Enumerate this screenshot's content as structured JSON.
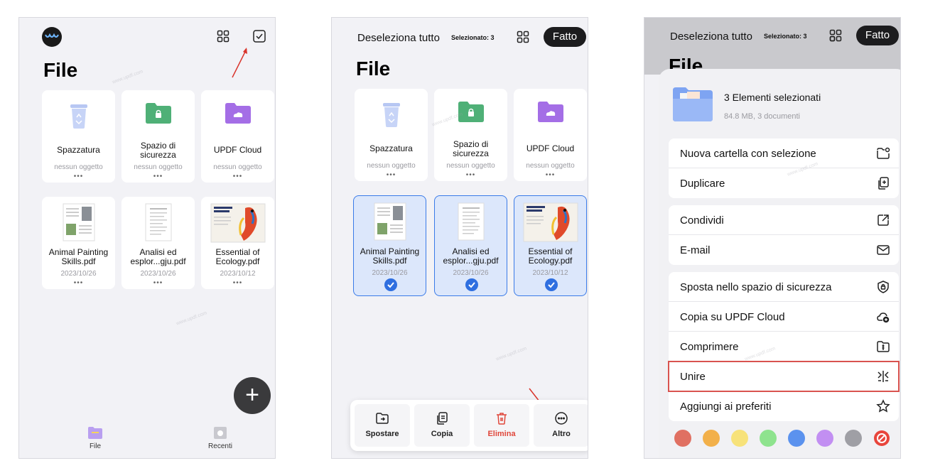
{
  "screen1": {
    "title": "File",
    "cards": [
      {
        "name": "Spazzatura",
        "sub": "nessun oggetto",
        "more": "•••"
      },
      {
        "name": "Spazio di sicurezza",
        "sub": "nessun oggetto",
        "more": "•••"
      },
      {
        "name": "UPDF Cloud",
        "sub": "nessun oggetto",
        "more": "•••"
      },
      {
        "name": "Animal Painting Skills.pdf",
        "sub": "2023/10/26",
        "more": "•••"
      },
      {
        "name": "Analisi ed esplor...gju.pdf",
        "sub": "2023/10/26",
        "more": "•••"
      },
      {
        "name": "Essential of Ecology.pdf",
        "sub": "2023/10/12",
        "more": "•••"
      }
    ],
    "fab": "+",
    "tabs": [
      {
        "label": "File"
      },
      {
        "label": "Recenti"
      }
    ]
  },
  "screen2": {
    "deselect": "Deseleziona tutto",
    "selected": "Selezionato: 3",
    "done": "Fatto",
    "title": "File",
    "cards": [
      {
        "name": "Spazzatura",
        "sub": "nessun oggetto",
        "more": "•••"
      },
      {
        "name": "Spazio di sicurezza",
        "sub": "nessun oggetto",
        "more": "•••"
      },
      {
        "name": "UPDF Cloud",
        "sub": "nessun oggetto",
        "more": "•••"
      },
      {
        "name": "Animal Painting Skills.pdf",
        "sub": "2023/10/26"
      },
      {
        "name": "Analisi ed esplor...gju.pdf",
        "sub": "2023/10/26"
      },
      {
        "name": "Essential of Ecology.pdf",
        "sub": "2023/10/12"
      }
    ],
    "actions": [
      {
        "label": "Spostare"
      },
      {
        "label": "Copia"
      },
      {
        "label": "Elimina"
      },
      {
        "label": "Altro"
      }
    ]
  },
  "screen3": {
    "deselect": "Deseleziona tutto",
    "selected": "Selezionato: 3",
    "done": "Fatto",
    "title": "File",
    "sel_title": "3 Elementi selezionati",
    "sel_sub": "84.8 MB, 3 documenti",
    "group1": [
      "Nuova cartella con selezione",
      "Duplicare"
    ],
    "group2": [
      "Condividi",
      "E-mail"
    ],
    "group3": [
      "Sposta nello spazio di sicurezza",
      "Copia su UPDF Cloud",
      "Comprimere",
      "Unire",
      "Aggiungi ai preferiti"
    ],
    "colors": [
      "#e07062",
      "#f2b04a",
      "#f7e27a",
      "#8ee38e",
      "#5b92ee",
      "#c28ff2",
      "#9f9fa5"
    ]
  },
  "watermark": "www.updf.com"
}
